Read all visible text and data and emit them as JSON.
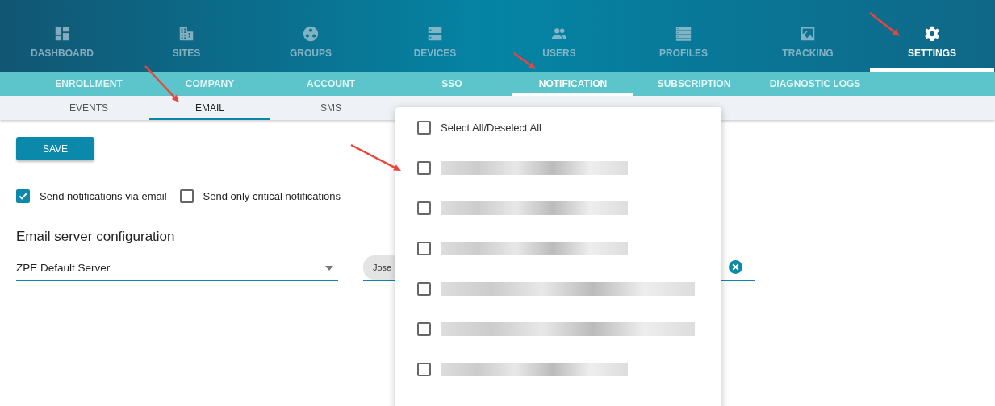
{
  "main_nav": [
    {
      "label": "DASHBOARD",
      "selected": false
    },
    {
      "label": "SITES",
      "selected": false
    },
    {
      "label": "GROUPS",
      "selected": false
    },
    {
      "label": "DEVICES",
      "selected": false
    },
    {
      "label": "USERS",
      "selected": false
    },
    {
      "label": "PROFILES",
      "selected": false
    },
    {
      "label": "TRACKING",
      "selected": false
    },
    {
      "label": "SETTINGS",
      "selected": true
    }
  ],
  "settings_tabs": [
    {
      "label": "ENROLLMENT",
      "selected": false
    },
    {
      "label": "COMPANY",
      "selected": false
    },
    {
      "label": "ACCOUNT",
      "selected": false
    },
    {
      "label": "SSO",
      "selected": false
    },
    {
      "label": "NOTIFICATION",
      "selected": true
    },
    {
      "label": "SUBSCRIPTION",
      "selected": false
    },
    {
      "label": "DIAGNOSTIC LOGS",
      "selected": false
    }
  ],
  "notification_tabs": [
    {
      "label": "EVENTS",
      "selected": false
    },
    {
      "label": "EMAIL",
      "selected": true
    },
    {
      "label": "SMS",
      "selected": false
    }
  ],
  "save_button": "SAVE",
  "options": [
    {
      "label": "Send notifications via email",
      "checked": true
    },
    {
      "label": "Send only critical notifications",
      "checked": false
    }
  ],
  "section_title": "Email server configuration",
  "server_select": {
    "value": "ZPE Default Server"
  },
  "recipients": {
    "chips": [
      "Jose"
    ]
  },
  "dropdown": {
    "select_all": {
      "label": "Select All/Deselect All",
      "checked": false
    },
    "items": [
      {
        "kind": "short",
        "checked": false
      },
      {
        "kind": "short",
        "checked": false
      },
      {
        "kind": "short",
        "checked": false
      },
      {
        "kind": "long",
        "checked": false
      },
      {
        "kind": "long",
        "checked": false
      },
      {
        "kind": "short",
        "checked": false
      }
    ]
  },
  "annotations": [
    {
      "kind": "arrow"
    },
    {
      "kind": "arrow"
    },
    {
      "kind": "arrow"
    },
    {
      "kind": "arrow"
    }
  ]
}
